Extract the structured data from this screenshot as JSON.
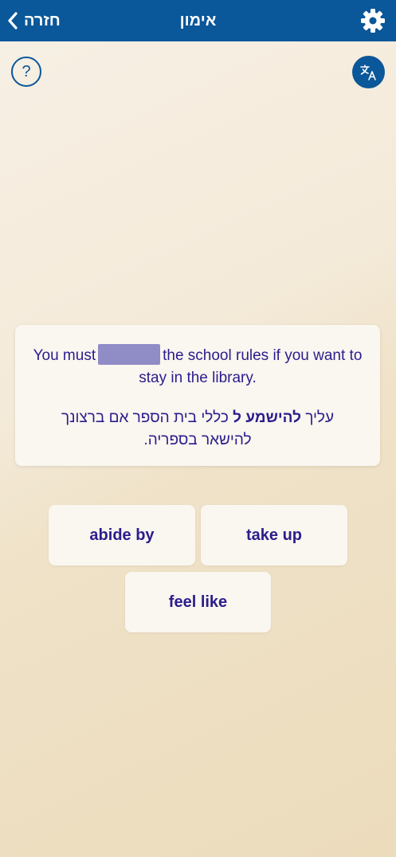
{
  "header": {
    "back_label": "חזרה",
    "title": "אימון",
    "icons": {
      "back": "chevron-left-icon",
      "settings": "gear-icon"
    }
  },
  "toolbar": {
    "help_label": "?",
    "translate_icon": "translate-icon"
  },
  "question": {
    "english_before": "You must",
    "english_after": "the school rules if you want to stay in the library.",
    "hebrew_before": "עליך",
    "hebrew_highlight": "להישמע ל",
    "hebrew_after": "כללי בית הספר אם ברצונך להישאר בספריה."
  },
  "answers": [
    {
      "label": "abide by"
    },
    {
      "label": "take up"
    },
    {
      "label": "feel like"
    }
  ],
  "colors": {
    "header_bg": "#0a5799",
    "text_primary": "#2b1d8c",
    "blank": "#8f8cc6",
    "card_bg": "#faf6f0"
  }
}
